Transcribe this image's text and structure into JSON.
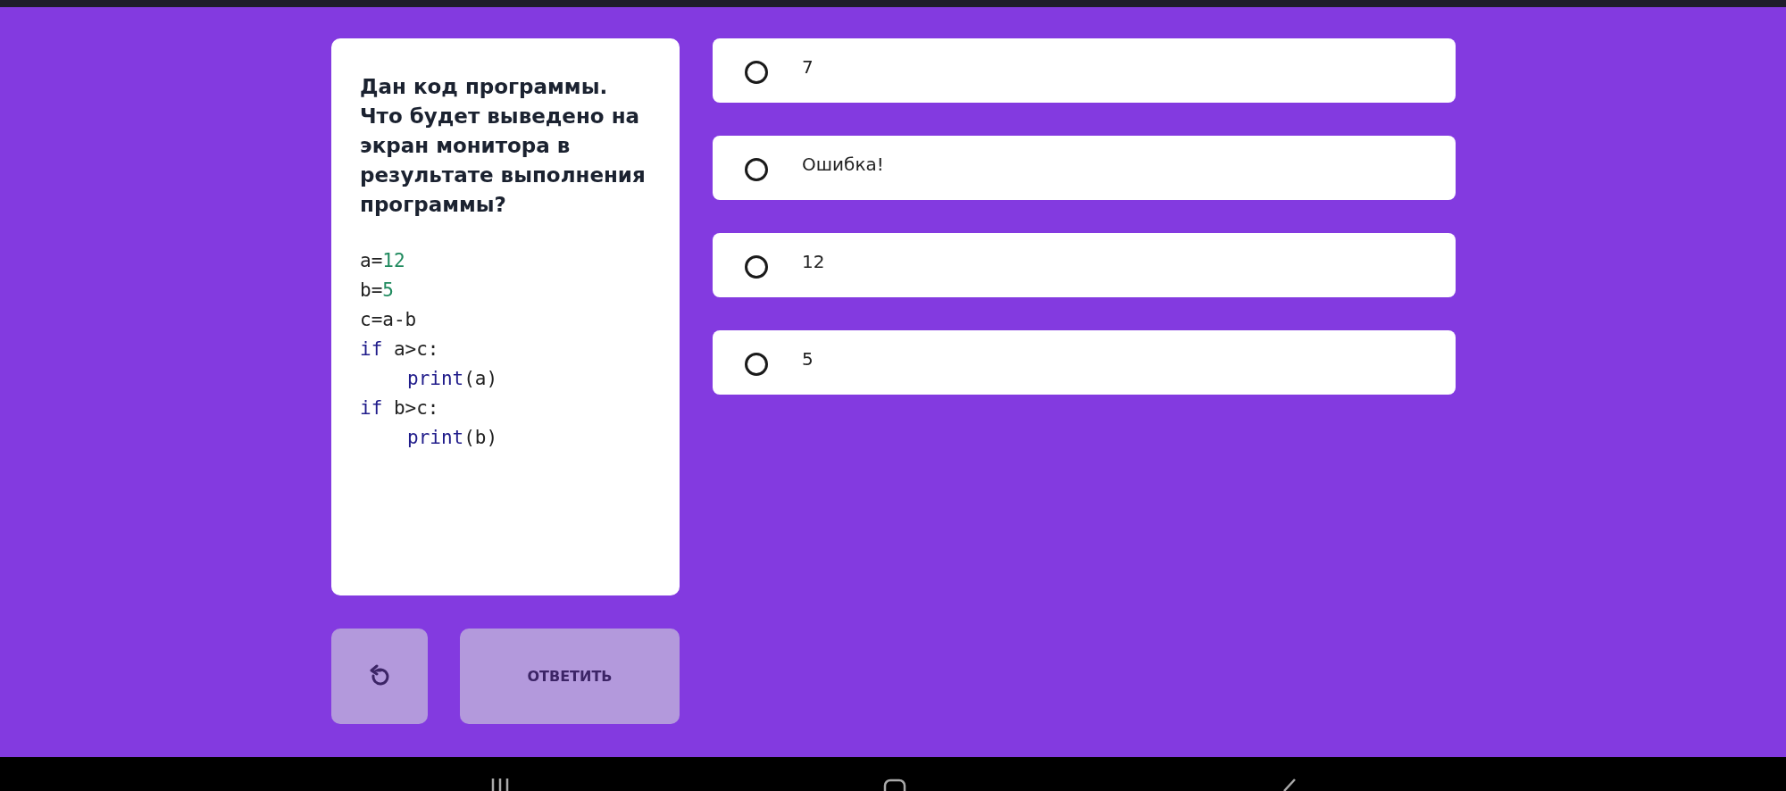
{
  "question": {
    "title": "Дан код программы. Что будет выведено на экран монитора в результате выполнения программы?",
    "code": [
      {
        "indent": false,
        "tokens": [
          {
            "text": "a=",
            "kind": "plain"
          },
          {
            "text": "12",
            "kind": "number"
          }
        ]
      },
      {
        "indent": false,
        "tokens": [
          {
            "text": "b=",
            "kind": "plain"
          },
          {
            "text": "5",
            "kind": "number"
          }
        ]
      },
      {
        "indent": false,
        "tokens": [
          {
            "text": "c=a-b",
            "kind": "plain"
          }
        ]
      },
      {
        "indent": false,
        "tokens": [
          {
            "text": "if",
            "kind": "keyword"
          },
          {
            "text": " a>c:",
            "kind": "plain"
          }
        ]
      },
      {
        "indent": true,
        "tokens": [
          {
            "text": "print",
            "kind": "keyword"
          },
          {
            "text": "(a)",
            "kind": "plain"
          }
        ]
      },
      {
        "indent": false,
        "tokens": [
          {
            "text": "if",
            "kind": "keyword"
          },
          {
            "text": " b>c:",
            "kind": "plain"
          }
        ]
      },
      {
        "indent": true,
        "tokens": [
          {
            "text": "print",
            "kind": "keyword"
          },
          {
            "text": "(b)",
            "kind": "plain"
          }
        ]
      }
    ]
  },
  "actions": {
    "reset": {
      "disabled": true
    },
    "submit": {
      "label": "ОТВЕТИТЬ",
      "disabled": true
    }
  },
  "options": [
    {
      "label": "7",
      "selected": false
    },
    {
      "label": "Ошибка!",
      "selected": false
    },
    {
      "label": "12",
      "selected": false
    },
    {
      "label": "5",
      "selected": false
    }
  ]
}
